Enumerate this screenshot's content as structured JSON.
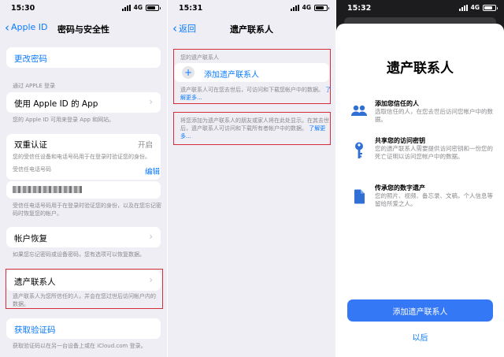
{
  "status": {
    "p1_time": "15:30",
    "p2_time": "15:31",
    "p3_time": "15:32",
    "network": "4G"
  },
  "p1": {
    "back": "Apple ID",
    "title": "密码与安全性",
    "change_password": "更改密码",
    "sign_in_header": "通过 APPLE 登录",
    "apps_using_id": "使用 Apple ID 的 App",
    "apps_footnote": "您的 Apple ID 可用来登录 App 和网站。",
    "two_factor": "双重认证",
    "two_factor_value": "开启",
    "two_factor_desc": "您的受信任设备和电话号码用于在登录时验证您的身份。",
    "trusted_phone_label": "受信任电话号码",
    "edit": "编辑",
    "trusted_phone_footnote": "受信任电话号码用于在登录时验证您的身份，以及在您忘记密码时恢复您的帐户。",
    "account_recovery": "帐户恢复",
    "recovery_footnote": "如果您忘记密码或设备密码，您有选项可以恢复数据。",
    "legacy_contact": "遗产联系人",
    "legacy_footnote": "遗产联系人为您所信任的人，并会在您过世后访问帐户内的数据。",
    "get_code": "获取验证码",
    "get_code_footnote": "获取验证码以在另一台设备上或在 iCloud.com 登录。"
  },
  "p2": {
    "back": "返回",
    "title": "遗产联系人",
    "section_header": "您的遗产联系人",
    "add_contact": "添加遗产联系人",
    "desc": "遗产联系人可在您去世后，可访问和下载您帐户中的数据。",
    "learn_more": "了解更多...",
    "desc2": "将您添加为遗产联系人的朋友或家人将在此处显示。在其去世后，遗产联系人可访问和下载所有者帐户中的数据。",
    "learn_more2": "了解更多..."
  },
  "p3": {
    "title": "遗产联系人",
    "f1_title": "添加您信任的人",
    "f1_desc": "选取信任的人，在您去世后访问您帐户中的数据。",
    "f2_title": "共享您的访问密钥",
    "f2_desc": "您的遗产联系人需要提供访问密钥和一份您的死亡证明以访问您帐户中的数据。",
    "f3_title": "传承您的数字遗产",
    "f3_desc": "您的照片、视频、备忘录、文稿，个人信息等留给所爱之人。",
    "add_button": "添加遗产联系人",
    "later": "以后"
  },
  "colors": {
    "accent": "#0a7aff",
    "button": "#3478f6",
    "highlight": "#d32f3a"
  }
}
